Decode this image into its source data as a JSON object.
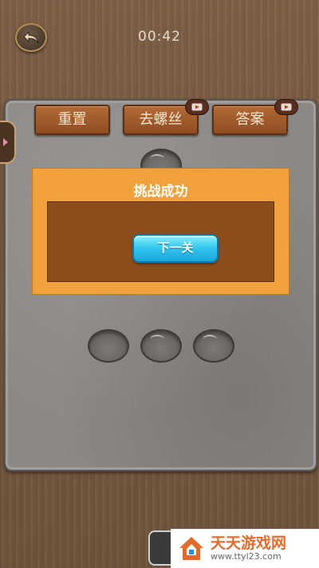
{
  "header": {
    "timer": "00:42",
    "back_icon": "back-arrow-icon"
  },
  "toolbar": {
    "reset_label": "重置",
    "remove_screw_label": "去螺丝",
    "answer_label": "答案",
    "video_icon": "video-play-icon"
  },
  "dialog": {
    "title": "挑战成功",
    "next_label": "下一关"
  },
  "watermark": {
    "name": "天天游戏网",
    "url": "www.ttyl23.com"
  },
  "colors": {
    "dialog_frame": "#f0a13c",
    "dialog_body": "#8c4d1c",
    "next_button": "#36c8ef",
    "wood_button": "#a55e2d"
  }
}
